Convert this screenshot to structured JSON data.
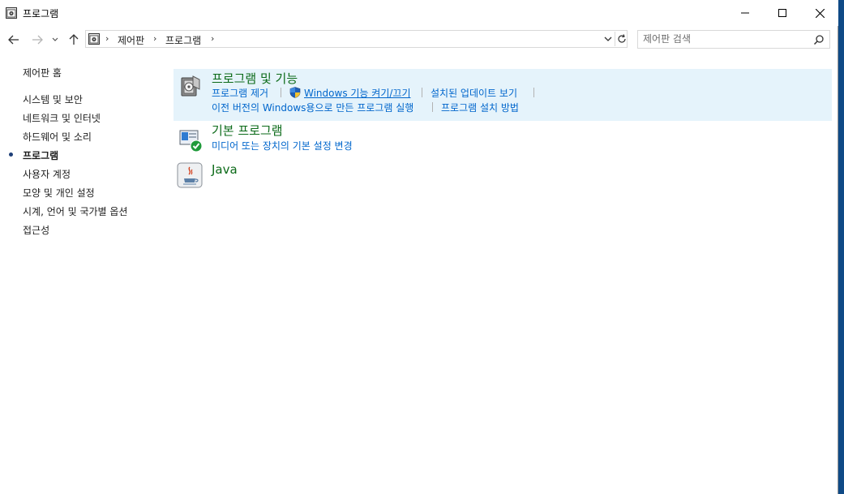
{
  "window": {
    "title": "프로그램",
    "icons": {
      "app": "control-panel-icon",
      "minimize": "minimize-icon",
      "maximize": "maximize-icon",
      "close": "close-icon"
    }
  },
  "nav": {
    "icons": [
      "back-arrow-icon",
      "forward-arrow-icon",
      "recent-dropdown-icon",
      "up-arrow-icon"
    ],
    "breadcrumbs": [
      "제어판",
      "프로그램"
    ],
    "search_placeholder": "제어판 검색"
  },
  "sidebar": {
    "items": [
      {
        "label": "제어판 홈"
      },
      {
        "label": "시스템 및 보안"
      },
      {
        "label": "네트워크 및 인터넷"
      },
      {
        "label": "하드웨어 및 소리"
      },
      {
        "label": "프로그램",
        "current": true
      },
      {
        "label": "사용자 계정"
      },
      {
        "label": "모양 및 개인 설정"
      },
      {
        "label": "시계, 언어 및 국가별 옵션"
      },
      {
        "label": "접근성"
      }
    ]
  },
  "categories": [
    {
      "title": "프로그램 및 기능",
      "icon": "programs-features-icon",
      "tasks_row1": [
        "프로그램 제거",
        "Windows 기능 켜기/끄기",
        "설치된 업데이트 보기"
      ],
      "tasks_row2": [
        "이전 버전의 Windows용으로 만든 프로그램 실행",
        "프로그램 설치 방법"
      ]
    },
    {
      "title": "기본 프로그램",
      "icon": "default-programs-icon",
      "tasks_row1": [
        "미디어 또는 장치의 기본 설정 변경"
      ]
    },
    {
      "title": "Java",
      "icon": "java-icon"
    }
  ],
  "colors": {
    "link": "#0066cc",
    "category_title": "#0b6a18",
    "hover_bg": "#e5f3fb"
  }
}
